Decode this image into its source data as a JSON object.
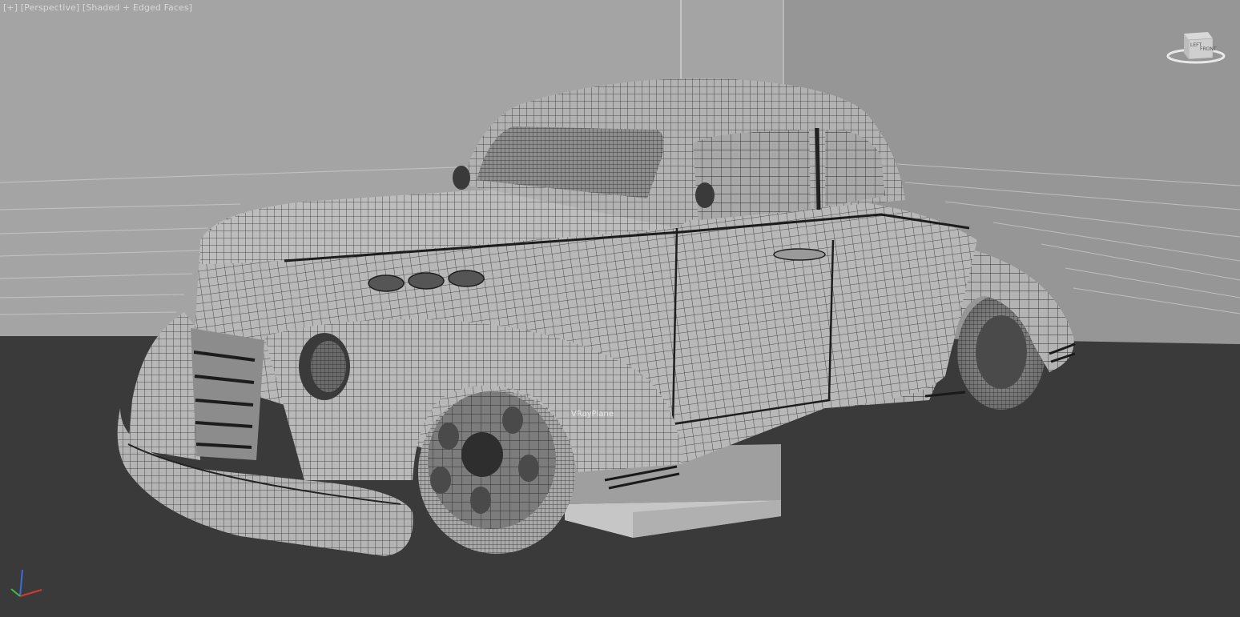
{
  "viewport": {
    "label_parts": [
      "[+]",
      "[Perspective]",
      "[Shaded + Edged Faces]"
    ]
  },
  "scene": {
    "object_label": "VRayPlane",
    "model": "low-rider-coupe-wireframe"
  },
  "viewcube": {
    "face_labels": [
      "LEFT",
      "FRONT"
    ]
  },
  "axis_tripod": {
    "axes": [
      "x",
      "y",
      "z"
    ]
  },
  "colors": {
    "background_wall": "#9c9c9c",
    "floor": "#3a3a3a",
    "model_fill": "#b5b5b5",
    "wire": "#2a2a2a",
    "axis_x": "#d23c2c",
    "axis_y": "#3cc03c",
    "axis_z": "#3c6cd8"
  }
}
